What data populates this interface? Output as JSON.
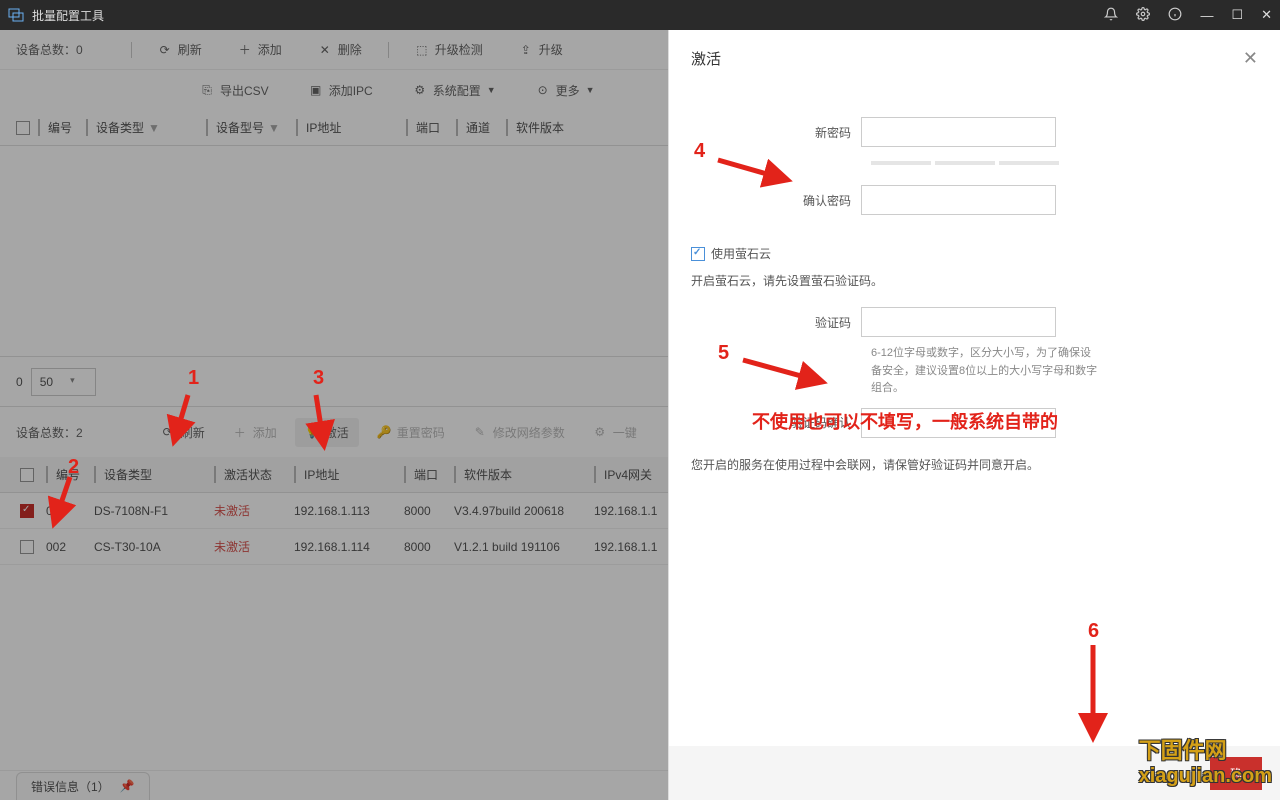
{
  "titlebar": {
    "app_title": "批量配置工具"
  },
  "top": {
    "count_label": "设备总数：0",
    "refresh": "刷新",
    "add": "添加",
    "delete": "删除",
    "upgrade_check": "升级检测",
    "upgrade": "升级",
    "export_csv": "导出CSV",
    "add_ipc": "添加IPC",
    "system_config": "系统配置",
    "more": "更多",
    "cols": {
      "id": "编号",
      "type": "设备类型",
      "model": "设备型号",
      "ip": "IP地址",
      "port": "端口",
      "channel": "通道",
      "software": "软件版本"
    }
  },
  "pager": {
    "page": "0",
    "size": "50"
  },
  "bottom": {
    "count_label": "设备总数：2",
    "refresh": "刷新",
    "add": "添加",
    "activate": "激活",
    "reset_pwd": "重置密码",
    "edit_net": "修改网络参数",
    "one_key": "一键",
    "cols": {
      "id": "编号",
      "type": "设备类型",
      "status": "激活状态",
      "ip": "IP地址",
      "port": "端口",
      "software": "软件版本",
      "gateway": "IPv4网关"
    },
    "rows": [
      {
        "checked": true,
        "id": "001",
        "type": "DS-7108N-F1",
        "status": "未激活",
        "ip": "192.168.1.113",
        "port": "8000",
        "software": "V3.4.97build 200618",
        "gateway": "192.168.1.1"
      },
      {
        "checked": false,
        "id": "002",
        "type": "CS-T30-10A",
        "status": "未激活",
        "ip": "192.168.1.114",
        "port": "8000",
        "software": "V1.2.1 build 191106",
        "gateway": "192.168.1.1"
      }
    ]
  },
  "footer": {
    "error_info": "错误信息（1）"
  },
  "panel": {
    "title": "激活",
    "new_pwd": "新密码",
    "confirm_pwd": "确认密码",
    "use_cloud": "使用萤石云",
    "cloud_hint": "开启萤石云，请先设置萤石验证码。",
    "verify_code": "验证码",
    "verify_help": "6-12位字母或数字，区分大小写，为了确保设备安全，建议设置8位以上的大小写字母和数字组合。",
    "verify_confirm": "验证码确认",
    "notice": "您开启的服务在使用过程中会联网，请保管好验证码并同意开启。",
    "ok": "确"
  },
  "annotations": {
    "a1": "1",
    "a2": "2",
    "a3": "3",
    "a4": "4",
    "a5": "5",
    "a6": "6",
    "red_note": "不使用也可以不填写，一般系统自带的"
  },
  "watermark": {
    "line1": "下固件网",
    "line2": "xiagujian.com"
  }
}
